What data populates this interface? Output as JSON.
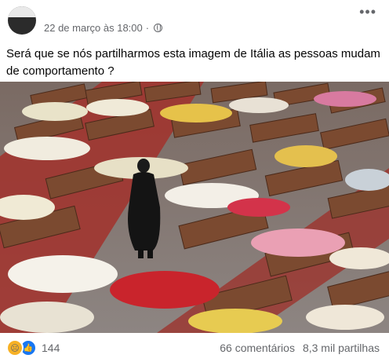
{
  "post": {
    "timestamp": "22 de março às 18:00",
    "separator": "·",
    "privacy_icon": "globe-icon",
    "more_icon": "more-options-icon",
    "caption": "Será que se nós partilharmos esta imagem de Itália as pessoas mudam de comportamento ?"
  },
  "photo": {
    "subject": "image-content"
  },
  "footer": {
    "reaction_icons": [
      "sad-reaction-icon",
      "like-reaction-icon"
    ],
    "reaction_count": "144",
    "comments": "66 comentários",
    "shares": "8,3 mil partilhas"
  },
  "colors": {
    "meta_text": "#65676b",
    "like_blue": "#1877f2",
    "sad_yellow": "#f7b125"
  }
}
